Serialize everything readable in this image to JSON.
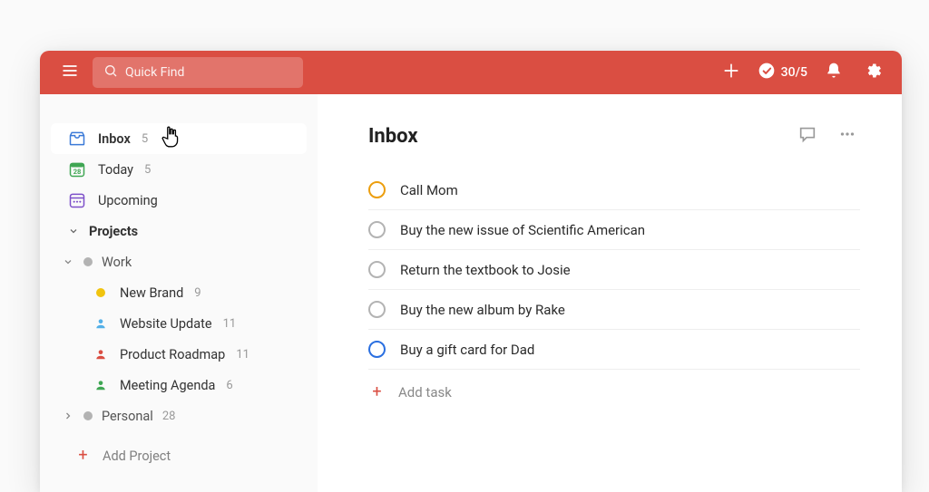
{
  "header": {
    "search_placeholder": "Quick Find",
    "productivity_label": "30/5"
  },
  "sidebar": {
    "inbox_label": "Inbox",
    "inbox_count": "5",
    "today_label": "Today",
    "today_count": "5",
    "today_date": "28",
    "upcoming_label": "Upcoming",
    "projects_label": "Projects",
    "groups": [
      {
        "name": "Work",
        "expanded": true,
        "items": [
          {
            "name": "New Brand",
            "count": "9",
            "type": "dot",
            "color": "#f1c40f"
          },
          {
            "name": "Website Update",
            "count": "11",
            "type": "person",
            "color": "#53b0e8"
          },
          {
            "name": "Product Roadmap",
            "count": "11",
            "type": "person",
            "color": "#da4e42"
          },
          {
            "name": "Meeting Agenda",
            "count": "6",
            "type": "person",
            "color": "#3fa653"
          }
        ]
      },
      {
        "name": "Personal",
        "count": "28",
        "expanded": false
      }
    ],
    "add_project_label": "Add Project"
  },
  "main": {
    "title": "Inbox",
    "tasks": [
      {
        "title": "Call Mom",
        "priority": "p1"
      },
      {
        "title": "Buy the new issue of Scientific American",
        "priority": "p4"
      },
      {
        "title": "Return the textbook to Josie",
        "priority": "p4"
      },
      {
        "title": "Buy the new album by Rake",
        "priority": "p4"
      },
      {
        "title": "Buy a gift card for Dad",
        "priority": "p3"
      }
    ],
    "add_task_label": "Add task"
  }
}
